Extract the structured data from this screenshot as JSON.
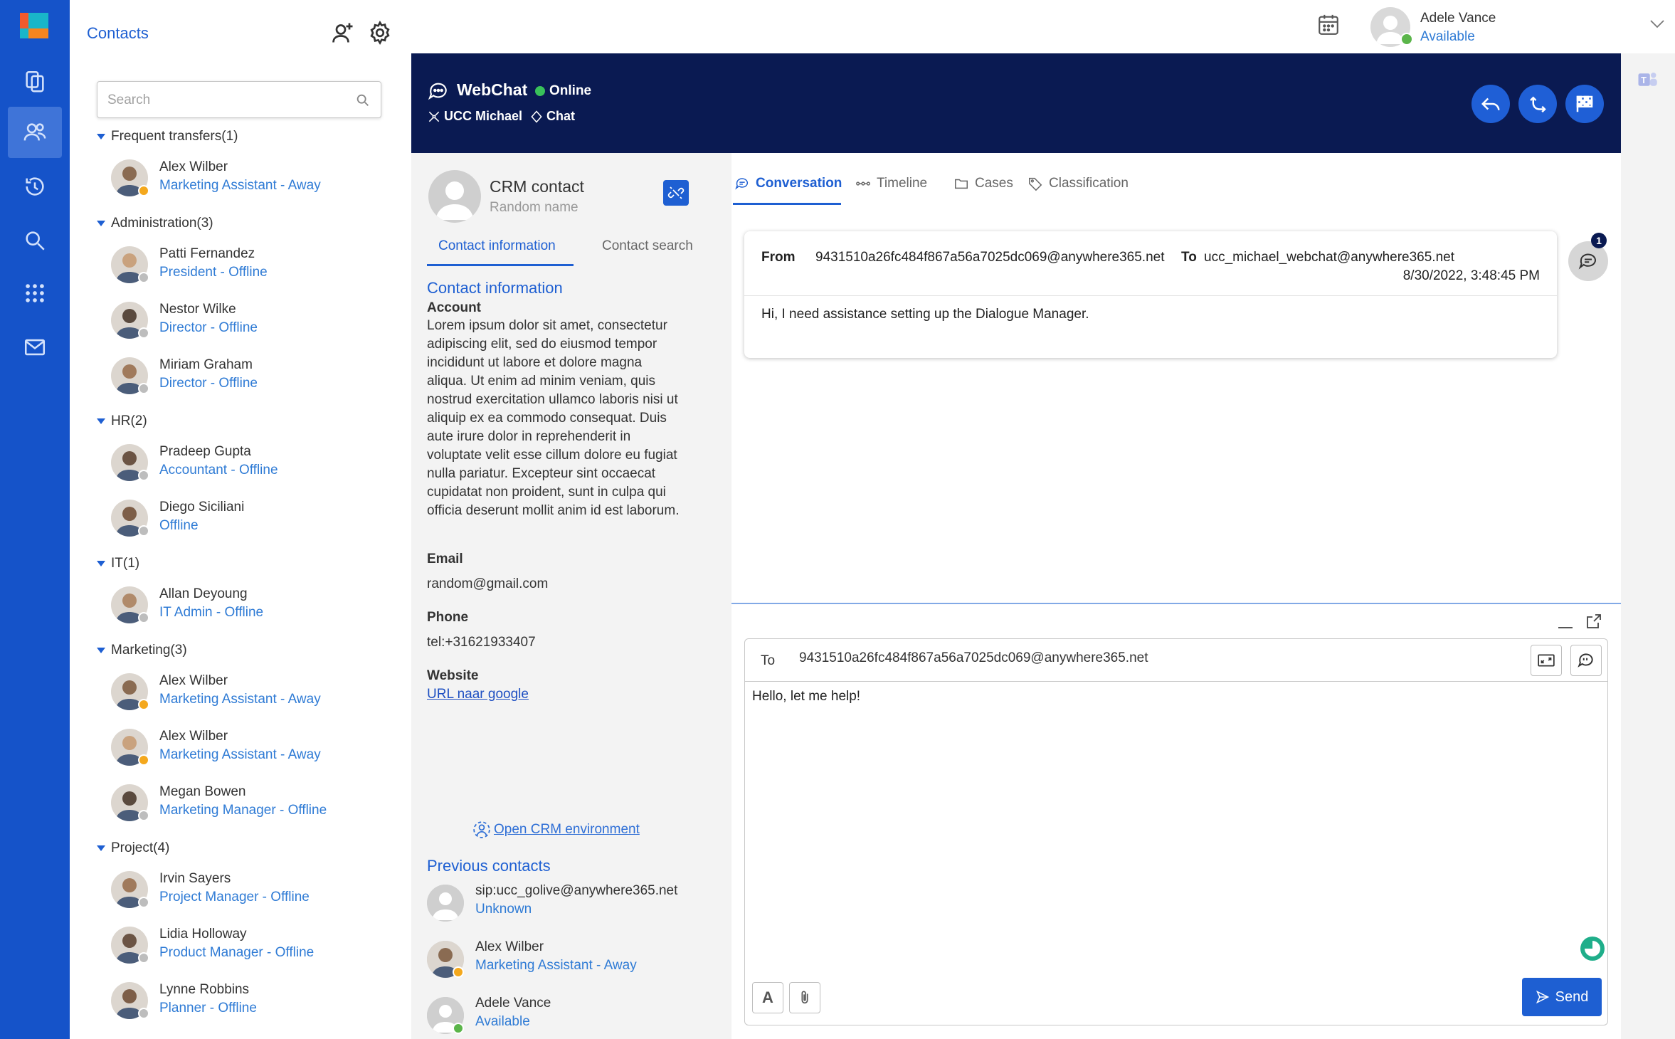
{
  "rail": {
    "items": [
      "sessions-icon",
      "contacts-icon",
      "history-icon",
      "search-icon",
      "apps-icon",
      "mail-icon"
    ],
    "active_index": 1
  },
  "contacts": {
    "title": "Contacts",
    "search_placeholder": "Search",
    "groups": [
      {
        "label": "Frequent transfers(1)",
        "people": [
          {
            "name": "Alex Wilber",
            "desc": "Marketing Assistant - Away",
            "status": "away"
          }
        ]
      },
      {
        "label": "Administration(3)",
        "people": [
          {
            "name": "Patti Fernandez",
            "desc": "President - Offline",
            "status": "offline"
          },
          {
            "name": "Nestor Wilke",
            "desc": "Director - Offline",
            "status": "offline"
          },
          {
            "name": "Miriam Graham",
            "desc": "Director - Offline",
            "status": "offline"
          }
        ]
      },
      {
        "label": "HR(2)",
        "people": [
          {
            "name": "Pradeep Gupta",
            "desc": "Accountant - Offline",
            "status": "offline"
          },
          {
            "name": "Diego Siciliani",
            "desc": "Offline",
            "status": "offline"
          }
        ]
      },
      {
        "label": "IT(1)",
        "people": [
          {
            "name": "Allan Deyoung",
            "desc": "IT Admin - Offline",
            "status": "offline"
          }
        ]
      },
      {
        "label": "Marketing(3)",
        "people": [
          {
            "name": "Alex Wilber",
            "desc": "Marketing Assistant - Away",
            "status": "away"
          },
          {
            "name": "Alex Wilber",
            "desc": "Marketing Assistant - Away",
            "status": "away"
          },
          {
            "name": "Megan Bowen",
            "desc": "Marketing Manager - Offline",
            "status": "offline"
          }
        ]
      },
      {
        "label": "Project(4)",
        "people": [
          {
            "name": "Irvin Sayers",
            "desc": "Project Manager - Offline",
            "status": "offline"
          },
          {
            "name": "Lidia Holloway",
            "desc": "Product Manager - Offline",
            "status": "offline"
          },
          {
            "name": "Lynne Robbins",
            "desc": "Planner - Offline",
            "status": "offline"
          }
        ]
      }
    ]
  },
  "user": {
    "name": "Adele Vance",
    "status": "Available"
  },
  "session": {
    "channel": "WebChat",
    "status": "Online",
    "queue": "UCC Michael",
    "type": "Chat"
  },
  "crm": {
    "title": "CRM contact",
    "subtitle": "Random name",
    "tabs": [
      "Contact information",
      "Contact search"
    ],
    "section_title": "Contact information",
    "account_label": "Account",
    "account_text": "Lorem ipsum dolor sit amet, consectetur adipiscing elit, sed do eiusmod tempor incididunt ut labore et dolore magna aliqua. Ut enim ad minim veniam, quis nostrud exercitation ullamco laboris nisi ut aliquip ex ea commodo consequat. Duis aute irure dolor in reprehenderit in voluptate velit esse cillum dolore eu fugiat nulla pariatur. Excepteur sint occaecat cupidatat non proident, sunt in culpa qui officia deserunt mollit anim id est laborum.",
    "email_label": "Email",
    "email": "random@gmail.com",
    "phone_label": "Phone",
    "phone": "tel:+31621933407",
    "website_label": "Website",
    "website_link": "URL naar google",
    "open_crm": "Open CRM environment",
    "previous_title": "Previous contacts",
    "previous": [
      {
        "name": "sip:ucc_golive@anywhere365.net",
        "desc": "Unknown",
        "status": "none"
      },
      {
        "name": "Alex Wilber",
        "desc": "Marketing Assistant - Away",
        "status": "away"
      },
      {
        "name": "Adele Vance",
        "desc": "Available",
        "status": "available"
      }
    ]
  },
  "conversation": {
    "tabs": [
      "Conversation",
      "Timeline",
      "Cases",
      "Classification"
    ],
    "message": {
      "from_label": "From",
      "from": "9431510a26fc484f867a56a7025dc069@anywhere365.net",
      "to_label": "To",
      "to": "ucc_michael_webchat@anywhere365.net",
      "timestamp": "8/30/2022, 3:48:45 PM",
      "body": "Hi, I need assistance setting up the Dialogue Manager."
    },
    "badge_count": "1"
  },
  "composer": {
    "to_label": "To",
    "to": "9431510a26fc484f867a56a7025dc069@anywhere365.net",
    "text": "Hello, let me help!",
    "format_label": "A",
    "send_label": "Send"
  },
  "colors": {
    "rail": "#1553c9",
    "session_header": "#0a1a52",
    "accent": "#1e5fd2",
    "away": "#f4a81d",
    "offline": "#bdbdbd",
    "available": "#5bb54a"
  }
}
